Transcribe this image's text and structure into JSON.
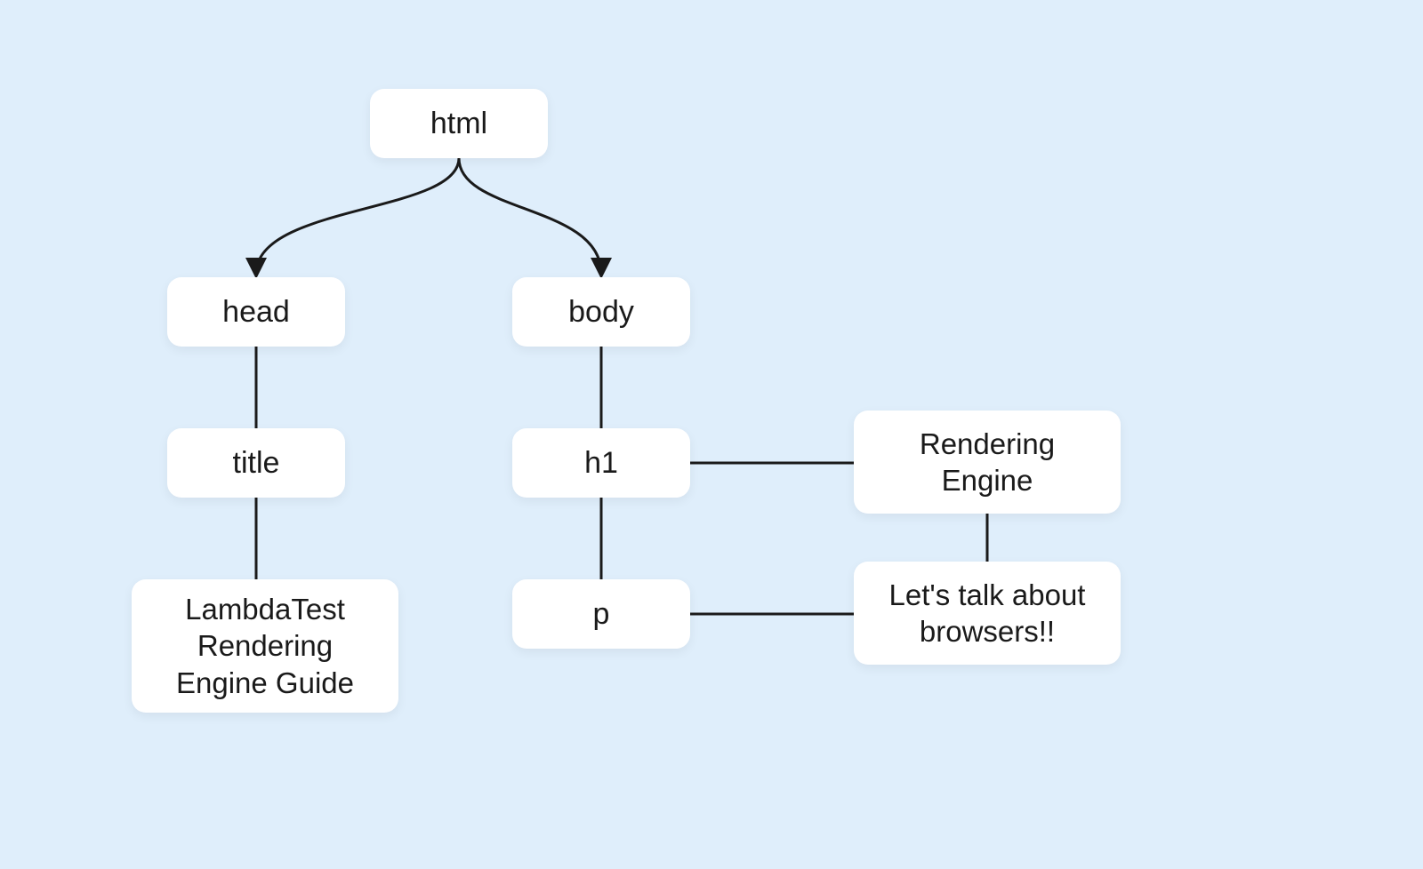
{
  "nodes": {
    "html": "html",
    "head": "head",
    "body": "body",
    "title": "title",
    "h1": "h1",
    "p": "p",
    "lambda": "LambdaTest Rendering Engine Guide",
    "rendering": "Rendering Engine",
    "lets": "Let's talk about browsers!!"
  }
}
